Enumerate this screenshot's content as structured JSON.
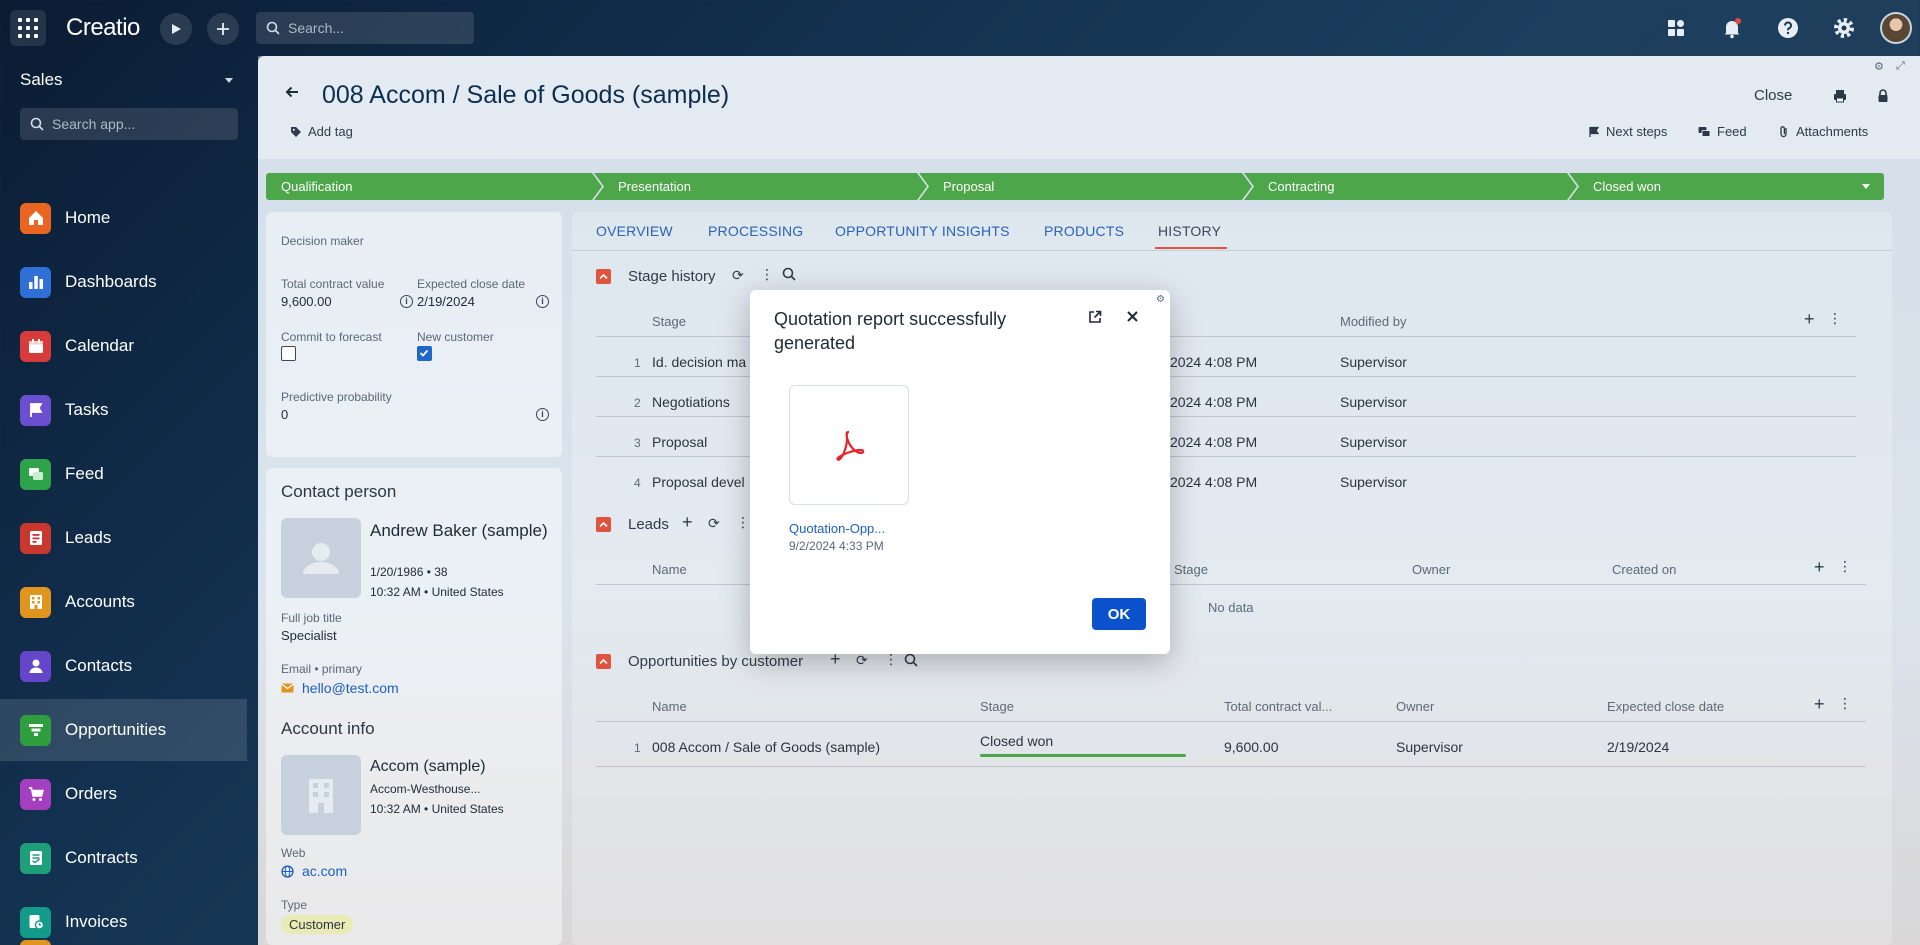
{
  "topbar": {
    "logo": "Creatio",
    "search_placeholder": "Search..."
  },
  "sidebar": {
    "app_title": "Sales",
    "search_placeholder": "Search app...",
    "items": [
      {
        "label": "Home",
        "color": "#e8661f"
      },
      {
        "label": "Dashboards",
        "color": "#2f6fd6"
      },
      {
        "label": "Calendar",
        "color": "#d73b3b"
      },
      {
        "label": "Tasks",
        "color": "#6a4fd1"
      },
      {
        "label": "Feed",
        "color": "#2ea34a"
      },
      {
        "label": "Leads",
        "color": "#c9382f"
      },
      {
        "label": "Accounts",
        "color": "#e0951f"
      },
      {
        "label": "Contacts",
        "color": "#6546c9"
      },
      {
        "label": "Opportunities",
        "color": "#2f9e3e"
      },
      {
        "label": "Orders",
        "color": "#a43fc0"
      },
      {
        "label": "Contracts",
        "color": "#1f9e7a"
      },
      {
        "label": "Invoices",
        "color": "#139a88"
      }
    ]
  },
  "header": {
    "title": "008 Accom / Sale of Goods (sample)",
    "add_tag": "Add tag",
    "close": "Close",
    "next_steps": "Next steps",
    "feed": "Feed",
    "attachments": "Attachments"
  },
  "stages": [
    "Qualification",
    "Presentation",
    "Proposal",
    "Contracting",
    "Closed won"
  ],
  "left_panel": {
    "decision_maker_label": "Decision maker",
    "total_contract_label": "Total contract value",
    "total_contract_value": "9,600.00",
    "expected_close_label": "Expected close date",
    "expected_close_value": "2/19/2024",
    "commit_label": "Commit to forecast",
    "new_customer_label": "New customer",
    "predictive_label": "Predictive probability",
    "predictive_value": "0",
    "contact_section": "Contact person",
    "contact_name": "Andrew Baker (sample)",
    "contact_birth": "1/20/1986 • 38",
    "contact_location": "10:32 AM • United States",
    "job_label": "Full job title",
    "job_value": "Specialist",
    "email_label": "Email • primary",
    "email_value": "hello@test.com",
    "account_section": "Account info",
    "account_name": "Accom (sample)",
    "account_sub": "Accom-Westhouse...",
    "account_location": "10:32 AM • United States",
    "web_label": "Web",
    "web_value": "ac.com",
    "type_label": "Type",
    "type_value": "Customer"
  },
  "tabs": [
    "OVERVIEW",
    "PROCESSING",
    "OPPORTUNITY INSIGHTS",
    "PRODUCTS",
    "HISTORY"
  ],
  "stage_history": {
    "title": "Stage history",
    "col_stage": "Stage",
    "col_modified": "Modified by",
    "rows": [
      {
        "n": "1",
        "stage": "Id. decision ma",
        "date": "2024 4:08 PM",
        "by": "Supervisor"
      },
      {
        "n": "2",
        "stage": "Negotiations",
        "date": "2024 4:08 PM",
        "by": "Supervisor"
      },
      {
        "n": "3",
        "stage": "Proposal",
        "date": "2024 4:08 PM",
        "by": "Supervisor"
      },
      {
        "n": "4",
        "stage": "Proposal devel",
        "date": "2024 4:08 PM",
        "by": "Supervisor"
      }
    ]
  },
  "leads": {
    "title": "Leads",
    "col_name": "Name",
    "col_stage": "Stage",
    "col_owner": "Owner",
    "col_created": "Created on",
    "empty": "No data"
  },
  "opps": {
    "title": "Opportunities by customer",
    "col_name": "Name",
    "col_stage": "Stage",
    "col_total": "Total contract val...",
    "col_owner": "Owner",
    "col_close": "Expected close date",
    "row": {
      "n": "1",
      "name": "008 Accom / Sale of Goods (sample)",
      "stage": "Closed won",
      "total": "9,600.00",
      "owner": "Supervisor",
      "close": "2/19/2024"
    }
  },
  "modal": {
    "title": "Quotation report successfully generated",
    "file_name": "Quotation-Opp...",
    "file_date": "9/2/2024 4:33 PM",
    "ok": "OK"
  }
}
